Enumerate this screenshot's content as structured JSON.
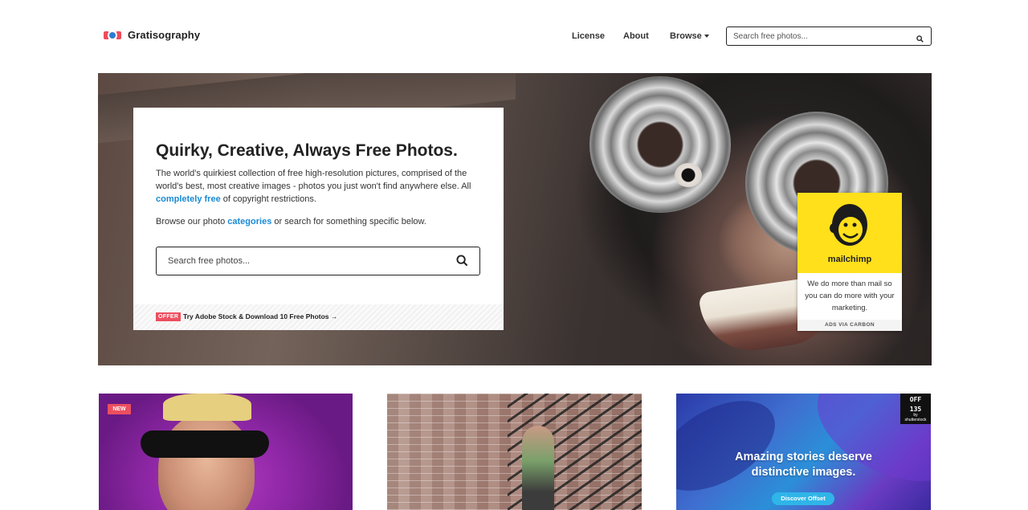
{
  "header": {
    "logo_text": "Gratisography",
    "nav": [
      {
        "label": "License"
      },
      {
        "label": "About"
      },
      {
        "label": "Browse"
      }
    ],
    "search": {
      "placeholder": "Search free photos..."
    }
  },
  "hero": {
    "title": "Quirky, Creative, Always Free Photos.",
    "desc_part1": "The world's quirkiest collection of free high-resolution pictures, comprised of the world's best, most creative images - photos you just won't find anywhere else. All ",
    "desc_link": "completely free",
    "desc_part2": " of copyright restrictions.",
    "browse_part1": "Browse our photo ",
    "browse_link": "categories",
    "browse_part2": " or search for something specific below.",
    "search": {
      "placeholder": "Search free photos..."
    },
    "offer": {
      "badge": "OFFER",
      "text": "Try Adobe Stock & Download 10 Free Photos →"
    }
  },
  "ad": {
    "brand": "mailchimp",
    "copy": "We do more than mail so you can do more with your marketing.",
    "footer": "ADS VIA CARBON"
  },
  "cards": {
    "card1": {
      "badge": "NEW"
    },
    "card3": {
      "logo_lines": [
        "OFF",
        "135",
        "by",
        "shutterstock"
      ],
      "headline": "Amazing stories deserve distinctive images.",
      "button": "Discover Offset"
    }
  },
  "colors": {
    "accent": "#1a8ad4",
    "badge_red": "#ec4f5f",
    "ad_yellow": "#ffe01b",
    "offset_button": "#2fb5e8"
  }
}
